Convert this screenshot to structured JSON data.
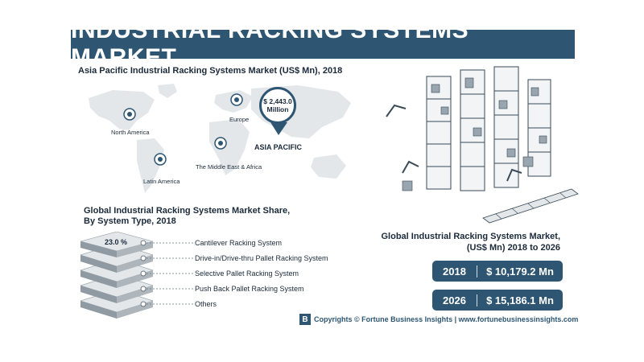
{
  "header": {
    "title": "INDUSTRIAL RACKING SYSTEMS MARKET"
  },
  "map_section": {
    "title": "Asia Pacific Industrial Racking Systems Market (US$ Mn), 2018",
    "regions": [
      "North America",
      "Europe",
      "Latin America",
      "The Middle East & Africa"
    ],
    "highlight": {
      "region": "ASIA PACIFIC",
      "value_line1": "$ 2,443.0",
      "value_line2": "Million"
    }
  },
  "share_section": {
    "title_line1": "Global Industrial Racking Systems Market Share,",
    "title_line2": "By System Type, 2018",
    "top_value": "23.0 %",
    "segments": [
      "Cantilever Racking System",
      "Drive-in/Drive-thru Pallet Racking System",
      "Selective Pallet Racking System",
      "Push Back Pallet Racking System",
      "Others"
    ]
  },
  "market_section": {
    "title_line1": "Global Industrial Racking Systems Market,",
    "title_line2": "(US$ Mn) 2018 to 2026",
    "rows": [
      {
        "year": "2018",
        "value": "$ 10,179.2 Mn"
      },
      {
        "year": "2026",
        "value": "$ 15,186.1 Mn"
      }
    ]
  },
  "footer": {
    "copyright": "Copyrights © Fortune Business Insights | www.fortunebusinessinsights.com"
  },
  "colors": {
    "accent": "#2e5672",
    "stack_light": "#e3e7ea",
    "stack_dark": "#8f9aa2",
    "map": "#e4e7ea"
  }
}
